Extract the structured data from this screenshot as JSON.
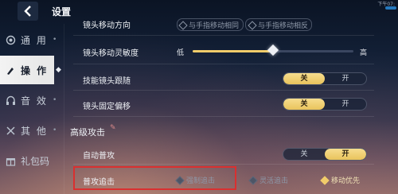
{
  "header": {
    "title": "设置",
    "time": "下午07:"
  },
  "sidebar": {
    "items": [
      {
        "label": "通 用",
        "icon": "target-icon",
        "active": false
      },
      {
        "label": "操 作",
        "icon": "brush-icon",
        "active": true
      },
      {
        "label": "音 效",
        "icon": "headphones-icon",
        "active": false
      },
      {
        "label": "其 他",
        "icon": "tools-icon",
        "active": false
      },
      {
        "label": "礼包码",
        "icon": "gift-icon",
        "active": false
      }
    ]
  },
  "camera_direction": {
    "label": "镜头移动方向",
    "options": [
      "与手指移动相同",
      "与手指移动相反"
    ]
  },
  "camera_sensitivity": {
    "label": "镜头移动灵敏度",
    "low": "低",
    "high": "高",
    "level": 0.5
  },
  "skill_camera_follow": {
    "label": "技能镜头跟随",
    "off": "关",
    "on": "开",
    "value": "关"
  },
  "camera_fixed_offset": {
    "label": "镜头固定偏移",
    "off": "关",
    "on": "开",
    "value": "关"
  },
  "advanced_attack": {
    "section_title": "高级攻击",
    "auto_attack": {
      "label": "自动普攻",
      "off": "关",
      "on": "开",
      "value": "开"
    },
    "chase": {
      "label": "普攻追击",
      "options": [
        "强制追击",
        "灵活追击",
        "移动优先"
      ],
      "selected": "移动优先"
    }
  },
  "colors": {
    "accent": "#f1cc6a",
    "highlight_box": "#d93030"
  }
}
